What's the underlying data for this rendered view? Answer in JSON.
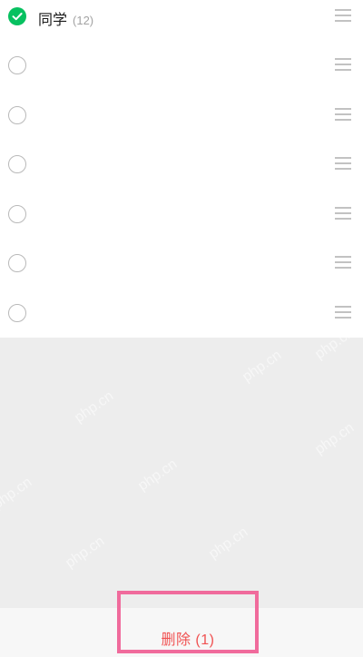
{
  "groups": [
    {
      "name": "同学",
      "count": "(12)",
      "checked": true
    },
    {
      "name": "",
      "count": "",
      "checked": false
    },
    {
      "name": "",
      "count": "",
      "checked": false
    },
    {
      "name": "",
      "count": "",
      "checked": false
    },
    {
      "name": "",
      "count": "",
      "checked": false
    },
    {
      "name": "",
      "count": "",
      "checked": false
    },
    {
      "name": "",
      "count": "",
      "checked": false
    }
  ],
  "bottom": {
    "delete_label": "删除 (1)"
  },
  "watermarks": [
    "php.cn",
    "php.cn",
    "php.cn",
    "php.cn",
    "php.cn",
    "php.cn",
    "php.cn",
    "php.cn"
  ],
  "colors": {
    "checked": "#07c160",
    "delete_text": "#f05252",
    "highlight_border": "#f06b9c"
  }
}
